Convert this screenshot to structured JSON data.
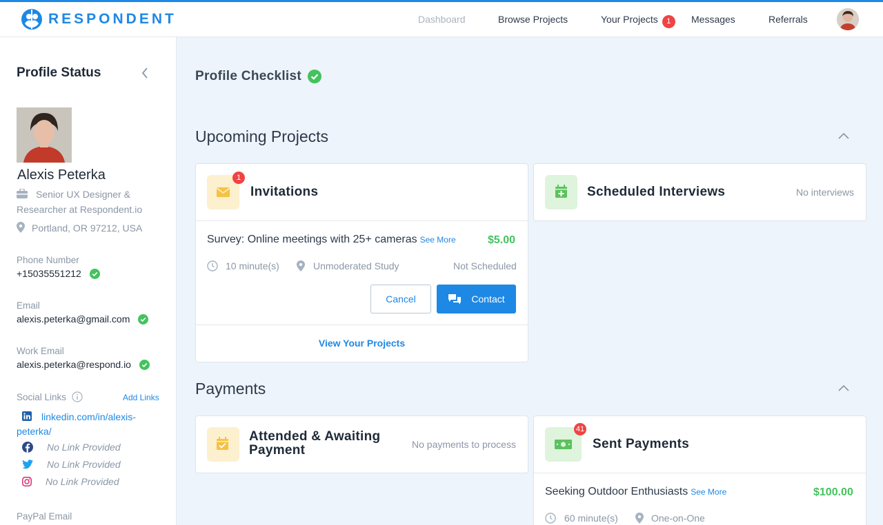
{
  "brand": {
    "name": "RESPONDENT",
    "accent": "#1e88e5"
  },
  "nav": {
    "dashboard": "Dashboard",
    "browse_projects": "Browse Projects",
    "your_projects": "Your Projects",
    "your_projects_badge": "1",
    "messages": "Messages",
    "referrals": "Referrals"
  },
  "sidebar": {
    "title": "Profile Status",
    "name": "Alexis Peterka",
    "job_line1": "Senior UX Designer &",
    "job_line2": "Researcher at Respondent.io",
    "location": "Portland, OR 97212, USA",
    "phone_label": "Phone Number",
    "phone_value": "+15035551212",
    "email_label": "Email",
    "email_value": "alexis.peterka@gmail.com",
    "work_email_label": "Work Email",
    "work_email_value": "alexis.peterka@respond.io",
    "social_label": "Social Links",
    "add_links": "Add Links",
    "linkedin_line1": "linkedin.com/in/alexis-",
    "linkedin_line2": "peterka/",
    "facebook": "No Link Provided",
    "twitter": "No Link Provided",
    "instagram": "No Link Provided",
    "paypal_label": "PayPal Email"
  },
  "checklist": {
    "title": "Profile Checklist"
  },
  "upcoming": {
    "title": "Upcoming Projects",
    "invitations": {
      "title": "Invitations",
      "badge": "1",
      "project_title": "Survey: Online meetings with 25+ cameras",
      "see_more": "See More",
      "price": "$5.00",
      "duration": "10 minute(s)",
      "type": "Unmoderated Study",
      "status": "Not Scheduled",
      "cancel": "Cancel",
      "contact": "Contact",
      "view_link": "View Your Projects"
    },
    "scheduled": {
      "title": "Scheduled Interviews",
      "empty": "No interviews"
    }
  },
  "payments": {
    "title": "Payments",
    "attended": {
      "title_line1": "Attended & Awaiting",
      "title_line2": "Payment",
      "empty": "No payments to process"
    },
    "sent": {
      "title": "Sent Payments",
      "badge": "41",
      "project_title": "Seeking Outdoor Enthusiasts",
      "see_more": "See More",
      "price": "$100.00",
      "duration": "60 minute(s)",
      "type": "One-on-One"
    }
  },
  "icons": [
    "logo-icon",
    "briefcase-icon",
    "location-pin-icon",
    "check-circle-icon",
    "info-icon",
    "linkedin-icon",
    "facebook-icon",
    "twitter-icon",
    "instagram-icon",
    "envelope-icon",
    "calendar-plus-icon",
    "calendar-check-icon",
    "money-icon",
    "clock-icon",
    "chat-icon",
    "chevron-up-icon",
    "chevron-left-icon"
  ],
  "colors": {
    "success": "#43c35e",
    "badge": "#ef4444",
    "link": "#1e88e5"
  }
}
